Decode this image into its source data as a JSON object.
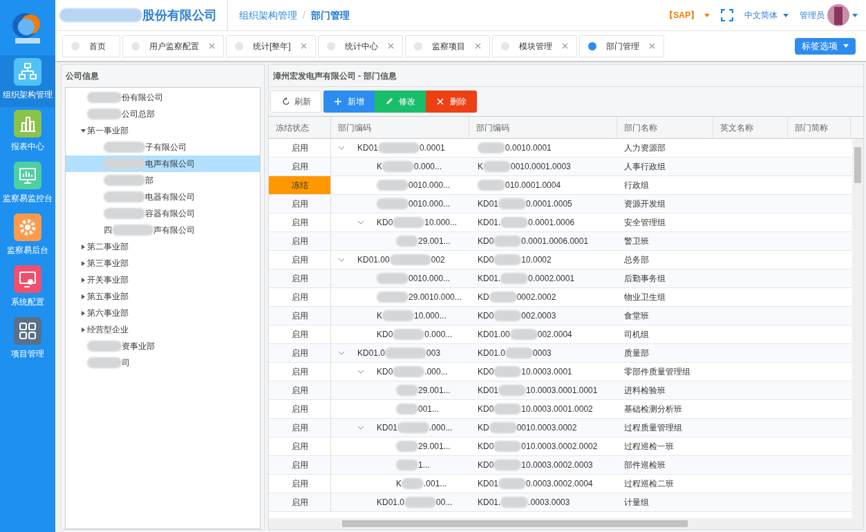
{
  "header": {
    "company_name_visible": "股份有限公司",
    "breadcrumb": [
      "组织架构管理",
      "部门管理"
    ],
    "breadcrumb_separator": "/",
    "sap": "【SAP】",
    "language": "中文简体",
    "user": "管理员"
  },
  "nav": [
    {
      "label": "组织架构管理",
      "color": "#4fc3f7",
      "selected": true
    },
    {
      "label": "报表中心",
      "color": "#8bc34a",
      "selected": false
    },
    {
      "label": "监察易监控台",
      "color": "#4dd0a0",
      "selected": false
    },
    {
      "label": "监察易后台",
      "color": "#ff9a4d",
      "selected": false
    },
    {
      "label": "系统配置",
      "color": "#f0506e",
      "selected": false
    },
    {
      "label": "项目管理",
      "color": "#5a7088",
      "selected": false
    }
  ],
  "tabs": [
    {
      "label": "首页",
      "selected": false,
      "closable": false
    },
    {
      "label": "用户监察配置",
      "selected": false,
      "closable": true
    },
    {
      "label": "统计[整年]",
      "selected": false,
      "closable": true
    },
    {
      "label": "统计中心",
      "selected": false,
      "closable": true
    },
    {
      "label": "监察项目",
      "selected": false,
      "closable": true
    },
    {
      "label": "模块管理",
      "selected": false,
      "closable": true
    },
    {
      "label": "部门管理",
      "selected": true,
      "closable": true
    }
  ],
  "tab_options": "标签选项",
  "company_panel": {
    "title": "公司信息",
    "tree": [
      {
        "suffix": "份有限公司",
        "selected": false
      },
      {
        "suffix": "公司总部",
        "selected": false
      },
      {
        "label": "第一事业部",
        "selected": false,
        "expanded": true,
        "children": [
          {
            "suffix": "子有限公司",
            "selected": false
          },
          {
            "suffix": "电声有限公司",
            "selected": true
          },
          {
            "suffix": "部",
            "selected": false
          },
          {
            "suffix": "电器有限公司",
            "selected": false
          },
          {
            "suffix": "容器有限公司",
            "selected": false
          },
          {
            "prefix": "四",
            "suffix": "声有限公司",
            "selected": false
          }
        ]
      },
      {
        "label": "第二事业部",
        "selected": false,
        "expanded": false
      },
      {
        "label": "第三事业部",
        "selected": false,
        "expanded": false
      },
      {
        "label": "开关事业部",
        "selected": false,
        "expanded": false
      },
      {
        "label": "第五事业部",
        "selected": false,
        "expanded": false
      },
      {
        "label": "第六事业部",
        "selected": false,
        "expanded": false
      },
      {
        "label": "经营型企业",
        "selected": false,
        "expanded": false
      },
      {
        "suffix": "资事业部",
        "selected": false
      },
      {
        "suffix": "司",
        "selected": false
      }
    ]
  },
  "dept_panel": {
    "title": "漳州宏发电声有限公司 - 部门信息",
    "buttons": [
      {
        "kind": "refresh",
        "label": "刷新"
      },
      {
        "kind": "add",
        "label": "新增"
      },
      {
        "kind": "edit",
        "label": "修改"
      },
      {
        "kind": "delete",
        "label": "删除"
      }
    ],
    "columns": [
      "冻结状态",
      "部门编码",
      "部门编码",
      "部门名称",
      "英文名称",
      "部门简称"
    ],
    "rows": [
      {
        "status": "启用",
        "frozen": false,
        "code_prefix": "KD01",
        "code_suffix": "0.0001",
        "code2_suffix": "0.0010.0001",
        "name": "人力资源部",
        "expanded": true,
        "children": [
          {
            "status": "启用",
            "frozen": false,
            "code_prefix": "K",
            "code_suffix": "0.000...",
            "code2_prefix": "K",
            "code2_suffix": "0010.0001.0003",
            "name": "人事行政组"
          },
          {
            "status": "冻结",
            "frozen": true,
            "code_suffix": "0010.000...",
            "code2_suffix": "010.0001.0004",
            "name": "行政组"
          },
          {
            "status": "启用",
            "frozen": false,
            "code_suffix": "0010.000...",
            "code2_prefix": "KD01",
            "code2_suffix": "0.0001.0005",
            "name": "资源开发组"
          },
          {
            "status": "启用",
            "frozen": false,
            "code_prefix": "KD0",
            "code_suffix": "10.000...",
            "code2_prefix": "KD01.",
            "code2_suffix": "0.0001.0006",
            "name": "安全管理组",
            "expanded": true,
            "children": [
              {
                "status": "启用",
                "frozen": false,
                "code_suffix": "29.001...",
                "code2_prefix": "KD0",
                "code2_suffix": "0.0001.0006.0001",
                "name": "警卫班"
              }
            ]
          }
        ]
      },
      {
        "status": "启用",
        "frozen": false,
        "code_prefix": "KD01.00",
        "code_suffix": "002",
        "code2_prefix": "KD0",
        "code2_suffix": "10.0002",
        "name": "总务部",
        "expanded": true,
        "children": [
          {
            "status": "启用",
            "frozen": false,
            "code_suffix": "0010.000...",
            "code2_prefix": "KD01.",
            "code2_suffix": "0.0002.0001",
            "name": "后勤事务组"
          },
          {
            "status": "启用",
            "frozen": false,
            "code_suffix": "29.0010.000...",
            "code2_prefix": "KD",
            "code2_suffix": "0002.0002",
            "name": "物业卫生组"
          },
          {
            "status": "启用",
            "frozen": false,
            "code_prefix": "K",
            "code_suffix": "10.000...",
            "code2_prefix": "KD0",
            "code2_suffix": "002.0003",
            "name": "食堂班"
          },
          {
            "status": "启用",
            "frozen": false,
            "code_prefix": "KD0",
            "code_suffix": "0.000...",
            "code2_prefix": "KD01.00",
            "code2_suffix": "002.0004",
            "name": "司机组"
          }
        ]
      },
      {
        "status": "启用",
        "frozen": false,
        "code_prefix": "KD01.0",
        "code_suffix": "003",
        "code2_prefix": "KD01.0",
        "code2_suffix": "0003",
        "name": "质量部",
        "expanded": true,
        "children": [
          {
            "status": "启用",
            "frozen": false,
            "code_prefix": "KD0",
            "code_suffix": ".000...",
            "code2_prefix": "KD0",
            "code2_suffix": "10.0003.0001",
            "name": "零部件质量管理组",
            "expanded": true,
            "children": [
              {
                "status": "启用",
                "frozen": false,
                "code_suffix": "29.001...",
                "code2_prefix": "KD01",
                "code2_suffix": "10.0003.0001.0001",
                "name": "进料检验班"
              },
              {
                "status": "启用",
                "frozen": false,
                "code_suffix": "001...",
                "code2_prefix": "KD0",
                "code2_suffix": "10.0003.0001.0002",
                "name": "基础检测分析班"
              }
            ]
          },
          {
            "status": "启用",
            "frozen": false,
            "code_prefix": "KD01",
            "code_suffix": ".000...",
            "code2_prefix": "KD",
            "code2_suffix": "0010.0003.0002",
            "name": "过程质量管理组",
            "expanded": true,
            "children": [
              {
                "status": "启用",
                "frozen": false,
                "code_suffix": "29.001...",
                "code2_prefix": "KD0",
                "code2_suffix": "010.0003.0002.0002",
                "name": "过程巡检一班"
              },
              {
                "status": "启用",
                "frozen": false,
                "code_suffix": "1...",
                "code2_prefix": "KD0",
                "code2_suffix": "10.0003.0002.0003",
                "name": "部件巡检班"
              },
              {
                "status": "启用",
                "frozen": false,
                "code_prefix": "K",
                "code_suffix": ".001...",
                "code2_prefix": "KD01",
                "code2_suffix": "0.0003.0002.0004",
                "name": "过程巡检二班"
              }
            ]
          },
          {
            "status": "启用",
            "frozen": false,
            "code_prefix": "KD01.0",
            "code_suffix": "00...",
            "code2_prefix": "KD01.",
            "code2_suffix": ".0003.0003",
            "name": "计量组"
          }
        ]
      }
    ]
  }
}
